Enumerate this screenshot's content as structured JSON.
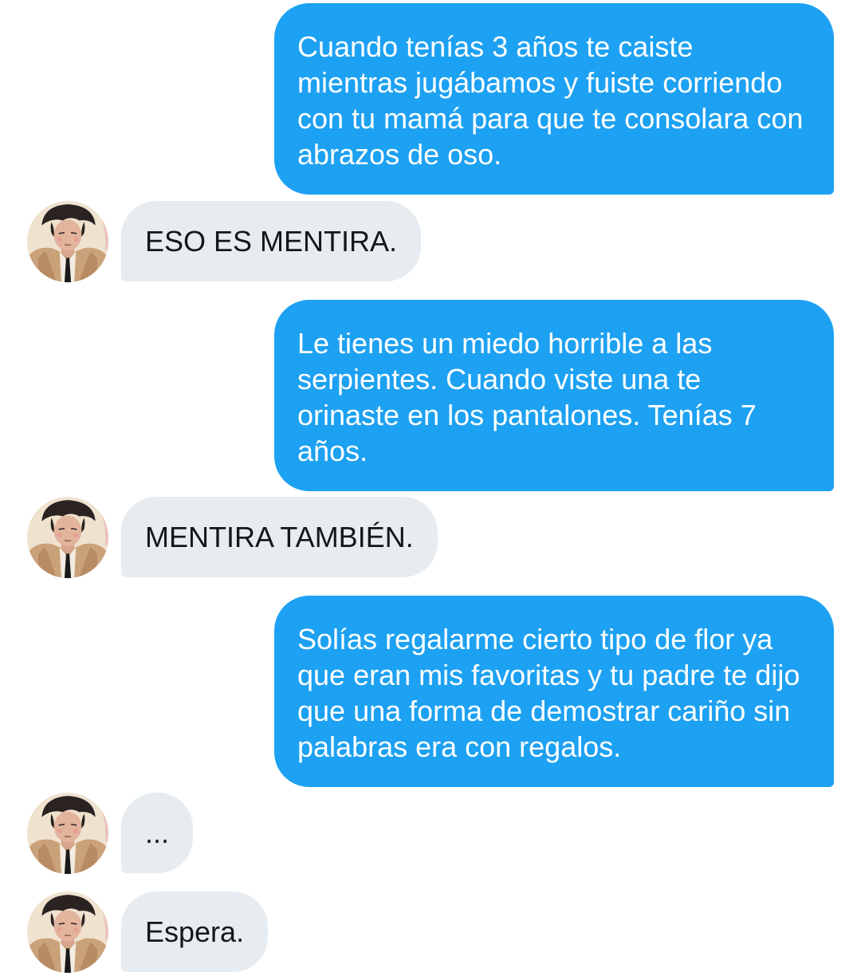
{
  "conversation": {
    "messages": [
      {
        "side": "outgoing",
        "text": "Cuando tenías 3 años te caiste mientras jugábamos y fuiste corriendo con tu mamá para que te consolara con abrazos de oso."
      },
      {
        "side": "incoming",
        "text": "ESO ES MENTIRA."
      },
      {
        "side": "outgoing",
        "text": "Le tienes un miedo horrible a las serpientes. Cuando viste una te orinaste en los pantalones. Tenías 7 años."
      },
      {
        "side": "incoming",
        "text": "MENTIRA TAMBIÉN."
      },
      {
        "side": "outgoing",
        "text": "Solías regalarme cierto tipo de flor ya que eran mis favoritas y tu padre te dijo que una forma de demostrar cariño sin palabras era con regalos."
      },
      {
        "side": "incoming",
        "text": "..."
      },
      {
        "side": "incoming",
        "text": "Espera."
      }
    ]
  },
  "colors": {
    "outgoing_bubble": "#1da1f2",
    "incoming_bubble": "#e6ecf0"
  },
  "icons": {
    "avatar": "user-avatar-portrait"
  }
}
